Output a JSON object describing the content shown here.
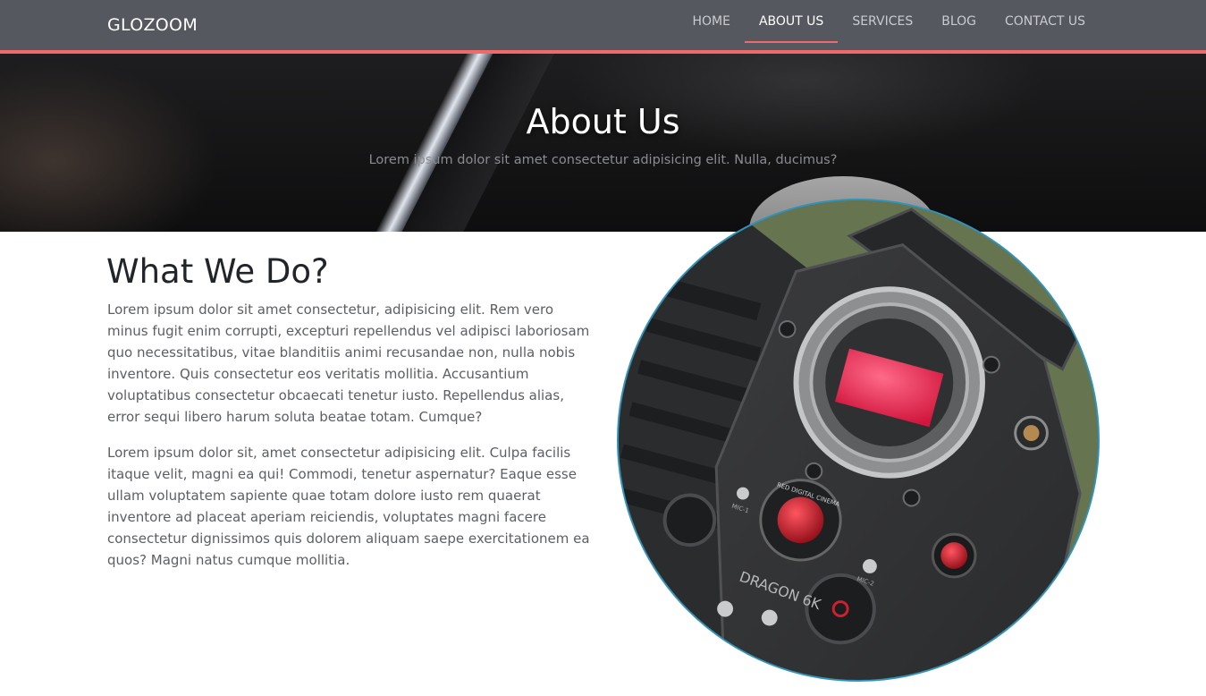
{
  "navbar": {
    "brand": "GLOZOOM",
    "links": [
      {
        "label": "HOME",
        "active": false
      },
      {
        "label": "ABOUT US",
        "active": true
      },
      {
        "label": "SERVICES",
        "active": false
      },
      {
        "label": "BLOG",
        "active": false
      },
      {
        "label": "CONTACT US",
        "active": false
      }
    ]
  },
  "hero": {
    "title": "About Us",
    "subtitle": "Lorem ipsum dolor sit amet consectetur adipisicing elit. Nulla, ducimus?"
  },
  "about": {
    "title": "What We Do?",
    "paragraphs": [
      "Lorem ipsum dolor sit amet consectetur, adipisicing elit. Rem vero minus fugit enim corrupti, excepturi repellendus vel adipisci laboriosam quo necessitatibus, vitae blanditiis animi recusandae non, nulla nobis inventore. Quis consectetur eos veritatis mollitia. Accusantium voluptatibus consectetur obcaecati tenetur iusto. Repellendus alias, error sequi libero harum soluta beatae totam. Cumque?",
      "Lorem ipsum dolor sit, amet consectetur adipisicing elit. Culpa facilis itaque velit, magni ea qui! Commodi, tenetur aspernatur? Eaque esse ullam voluptatem sapiente quae totam dolore iusto rem quaerat inventore ad placeat aperiam reiciendis, voluptates magni facere consectetur dignissimos quis dolorem aliquam saepe exercitationem ea quos? Magni natus cumque mollitia."
    ],
    "image_text": {
      "model": "DRAGON 6K",
      "badge": "RED DIGITAL CINEMA",
      "mic1": "MIC-1",
      "mic2": "MIC-2"
    }
  },
  "colors": {
    "navbar_bg": "#55585f",
    "accent": "#f06a6a",
    "circle_border": "#2f94bd"
  }
}
